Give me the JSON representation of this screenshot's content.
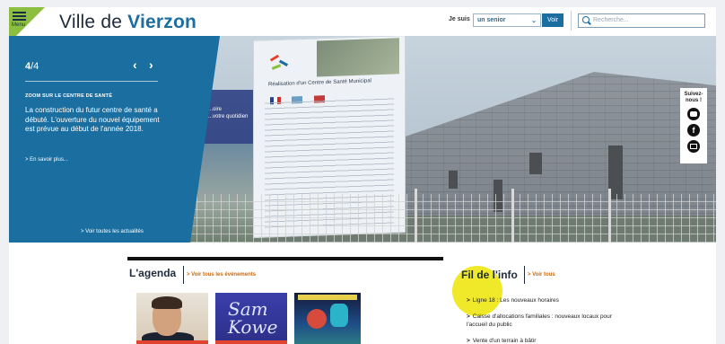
{
  "header": {
    "menu_label": "Menu",
    "site_title_prefix": "Ville de",
    "site_title_strong": "Vierzon",
    "iam_label": "Je suis",
    "profile_select_value": "un senior",
    "go_label": "Voir",
    "search_placeholder": "Recherche...",
    "menu_icon": "hamburger-icon",
    "search_icon": "magnifier-icon"
  },
  "hero": {
    "slide_current": "4",
    "slide_total": "/4",
    "prev_label": "‹",
    "next_label": "›",
    "zoom_title": "ZOOM SUR LE CENTRE DE SANTÉ",
    "zoom_text": "La construction du futur centre de santé a débuté. L'ouverture du nouvel équipement est prévue au début de l'année 2018.",
    "more_label": "> En savoir plus...",
    "all_news_label": "> Voir toutes les actualités",
    "billboard_title": "Réalisation d'un Centre de Santé Municipal",
    "poster_line1": "...oire",
    "poster_line2": "...votre quotidien"
  },
  "follow": {
    "label_line1": "Suivez-",
    "label_line2": "nous !",
    "icons": [
      "youtube-icon",
      "facebook-icon",
      "mail-icon"
    ],
    "facebook_glyph": "f"
  },
  "agenda": {
    "title": "L'agenda",
    "link": "> Voir tous les événements",
    "thumb2_script": "Sam Kowe"
  },
  "fil": {
    "title": "Fil de l'info",
    "link": "> Voir tous",
    "items": [
      "Ligne 18 : Les nouveaux horaires",
      "Caisse d'allocations familiales : nouveaux locaux pour l'accueil du public",
      "Vente d'un terrain à bâtir"
    ]
  },
  "colors": {
    "brand_blue": "#1a6ea0",
    "menu_green": "#8cbf3f",
    "link_orange": "#c46a12",
    "highlight_yellow": "#f0e92a"
  }
}
